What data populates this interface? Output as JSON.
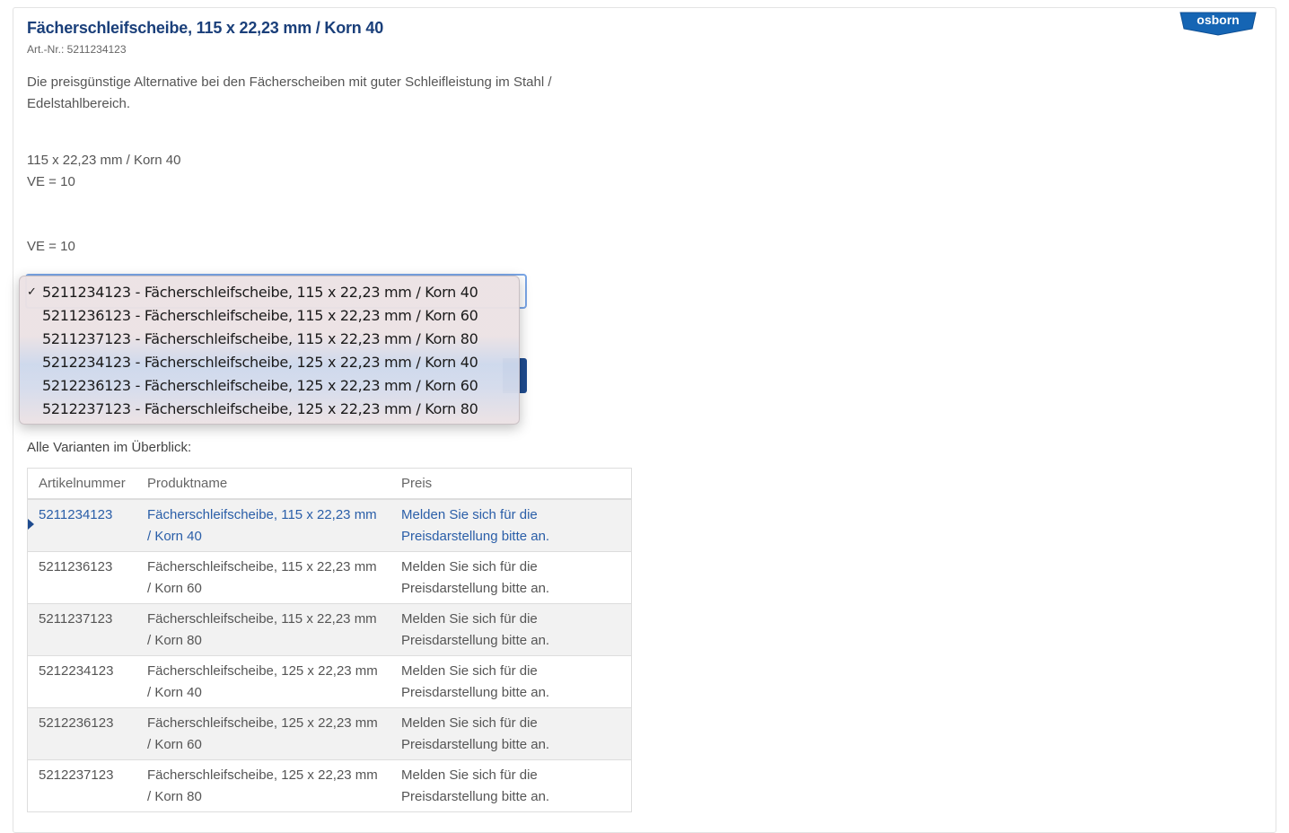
{
  "product": {
    "title": "Fächerschleifscheibe, 115 x 22,23 mm / Korn 40",
    "article_number": "Art.-Nr.: 5211234123",
    "description": "Die preisgünstige Alternative bei den Fächerscheiben mit guter Schleifleistung im Stahl / Edelstahlbereich.",
    "spec_line1": "115 x 22,23 mm / Korn 40",
    "spec_line2": "VE = 10",
    "spec_line3": "VE = 10"
  },
  "brand": {
    "logo_text": "osborn",
    "color": "#1565b4"
  },
  "variant_select": {
    "selected_index": 0,
    "options": [
      "5211234123 - Fächerschleifscheibe, 115 x 22,23 mm / Korn 40",
      "5211236123 - Fächerschleifscheibe, 115 x 22,23 mm / Korn 60",
      "5211237123 - Fächerschleifscheibe, 115 x 22,23 mm / Korn 80",
      "5212234123 - Fächerschleifscheibe, 125 x 22,23 mm / Korn 40",
      "5212236123 - Fächerschleifscheibe, 125 x 22,23 mm / Korn 60",
      "5212237123 - Fächerschleifscheibe, 125 x 22,23 mm / Korn 80"
    ],
    "check_icon": "checkmark-icon"
  },
  "overview": {
    "heading": "Alle Varianten im Überblick:",
    "columns": [
      "Artikelnummer",
      "Produktname",
      "Preis"
    ],
    "rows": [
      {
        "artnr": "5211234123",
        "name": "Fächerschleifscheibe, 115 x 22,23 mm / Korn 40",
        "price": "Melden Sie sich für die Preisdarstellung bitte an."
      },
      {
        "artnr": "5211236123",
        "name": "Fächerschleifscheibe, 115 x 22,23 mm / Korn 60",
        "price": "Melden Sie sich für die Preisdarstellung bitte an."
      },
      {
        "artnr": "5211237123",
        "name": "Fächerschleifscheibe, 115 x 22,23 mm / Korn 80",
        "price": "Melden Sie sich für die Preisdarstellung bitte an."
      },
      {
        "artnr": "5212234123",
        "name": "Fächerschleifscheibe, 125 x 22,23 mm / Korn 40",
        "price": "Melden Sie sich für die Preisdarstellung bitte an."
      },
      {
        "artnr": "5212236123",
        "name": "Fächerschleifscheibe, 125 x 22,23 mm / Korn 60",
        "price": "Melden Sie sich für die Preisdarstellung bitte an."
      },
      {
        "artnr": "5212237123",
        "name": "Fächerschleifscheibe, 125 x 22,23 mm / Korn 80",
        "price": "Melden Sie sich für die Preisdarstellung bitte an."
      }
    ]
  }
}
